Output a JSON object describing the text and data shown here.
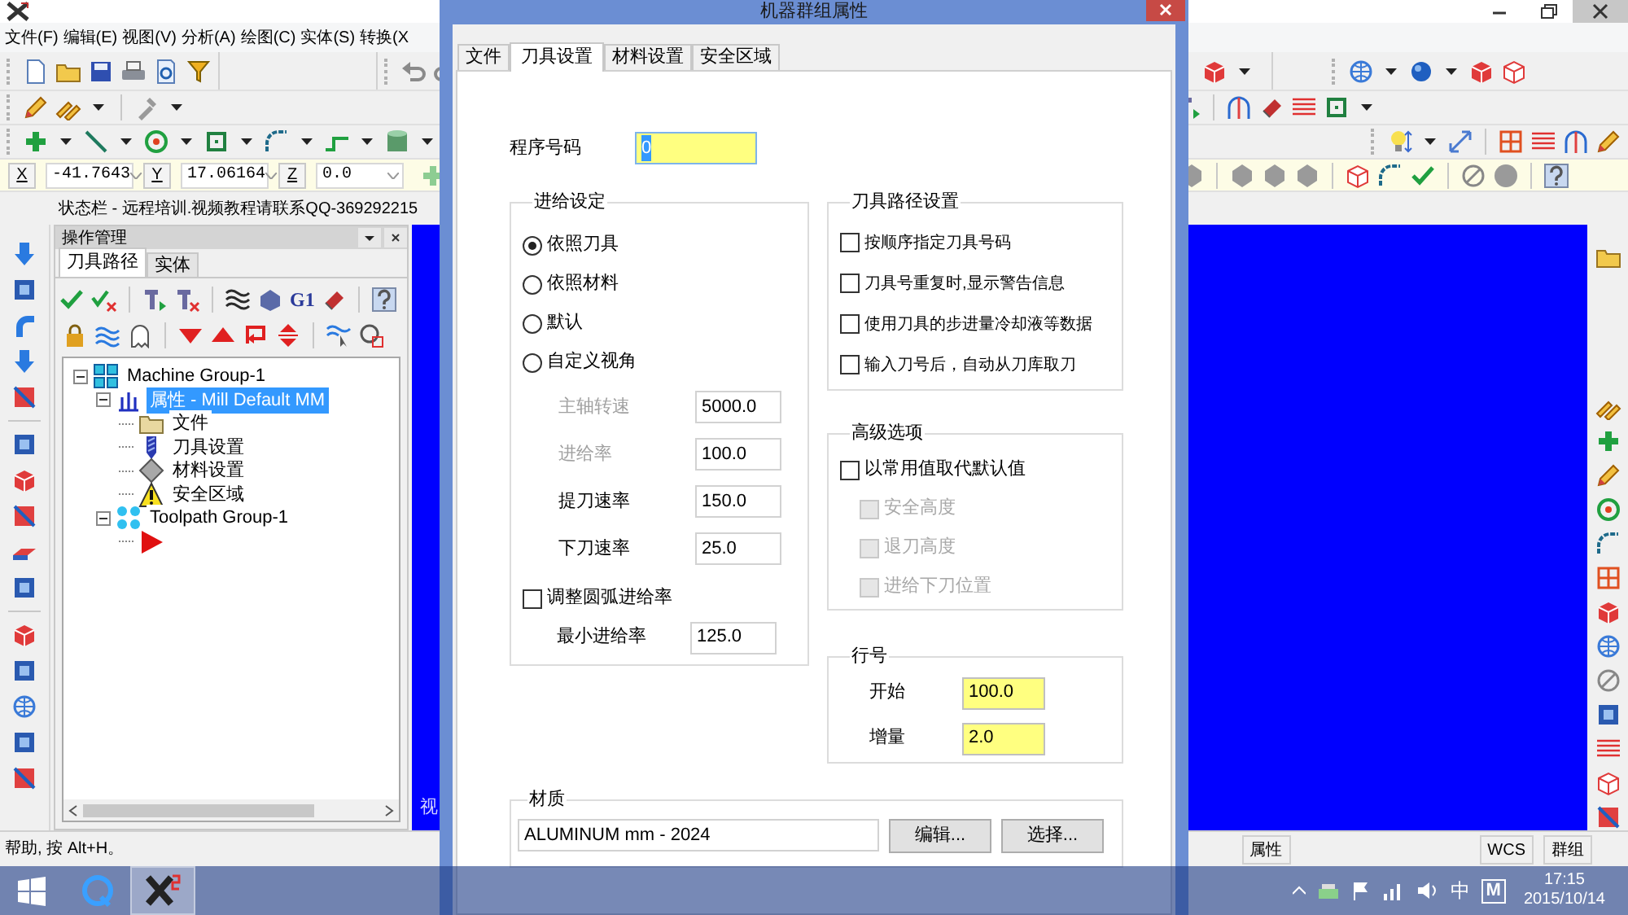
{
  "app": {
    "menu": [
      "文件(F)",
      "编辑(E)",
      "视图(V)",
      "分析(A)",
      "绘图(C)",
      "实体(S)",
      "转换(X"
    ],
    "coordinates": [
      {
        "axis": "X",
        "value": "-41.7643"
      },
      {
        "axis": "Y",
        "value": "17.06164"
      },
      {
        "axis": "Z",
        "value": "0.0"
      }
    ],
    "status_line": "状态栏 - 远程培训.视频教程请联系QQ-369292215",
    "manager": {
      "title": "操作管理",
      "tabs": [
        {
          "label": "刀具路径",
          "selected": true
        },
        {
          "label": "实体",
          "selected": false
        }
      ],
      "toolbar_label": "G1",
      "tree": [
        {
          "kind": "machine-group",
          "label": "Machine Group-1",
          "expanded": true,
          "selected": false,
          "children": [
            {
              "kind": "properties",
              "label": "属性 - Mill Default MM",
              "expanded": true,
              "selected": true,
              "children": [
                {
                  "kind": "files",
                  "label": "文件",
                  "selected": false
                },
                {
                  "kind": "tool",
                  "label": "刀具设置",
                  "selected": false
                },
                {
                  "kind": "material",
                  "label": "材料设置",
                  "selected": false
                },
                {
                  "kind": "safety",
                  "label": "安全区域",
                  "selected": false
                }
              ]
            },
            {
              "kind": "toolpath-group",
              "label": "Toolpath Group-1",
              "expanded": true,
              "selected": false,
              "children": [
                {
                  "kind": "operation-pointer",
                  "selected": false
                }
              ]
            }
          ]
        }
      ]
    },
    "viewport_text": "视",
    "status_bar": {
      "help": "帮助, 按 Alt+H。",
      "items": [
        "属性",
        "WCS",
        "群组"
      ]
    }
  },
  "dialog": {
    "title": "机器群组属性",
    "tabs": [
      {
        "label": "文件",
        "selected": false
      },
      {
        "label": "刀具设置",
        "selected": true
      },
      {
        "label": "材料设置",
        "selected": false
      },
      {
        "label": "安全区域",
        "selected": false
      }
    ],
    "program_number": {
      "label": "程序号码",
      "value": "0",
      "highlighted": true,
      "text_selected": true
    },
    "feed": {
      "title": "进给设定",
      "options": [
        {
          "label": "依照刀具",
          "selected": true
        },
        {
          "label": "依照材料",
          "selected": false
        },
        {
          "label": "默认",
          "selected": false
        },
        {
          "label": "自定义视角",
          "selected": false
        }
      ],
      "rates": [
        {
          "label": "主轴转速",
          "value": "5000.0",
          "disabled": true
        },
        {
          "label": "进给率",
          "value": "100.0",
          "disabled": true
        },
        {
          "label": "提刀速率",
          "value": "150.0",
          "disabled": false
        },
        {
          "label": "下刀速率",
          "value": "25.0",
          "disabled": false
        }
      ],
      "arc_feed": {
        "label": "调整圆弧进给率",
        "checked": false
      },
      "min_feed": {
        "label": "最小进给率",
        "value": "125.0"
      }
    },
    "toolpath_settings": {
      "title": "刀具路径设置",
      "options": [
        {
          "label": "按顺序指定刀具号码",
          "checked": false
        },
        {
          "label": "刀具号重复时,显示警告信息",
          "checked": false
        },
        {
          "label": "使用刀具的步进量冷却液等数据",
          "checked": false
        },
        {
          "label": "输入刀号后，自动从刀库取刀",
          "checked": false
        }
      ]
    },
    "advanced": {
      "title": "高级选项",
      "option": {
        "label": "以常用值取代默认值",
        "checked": false
      },
      "sub_options": [
        {
          "label": "安全高度",
          "checked": false,
          "disabled": true
        },
        {
          "label": "退刀高度",
          "checked": false,
          "disabled": true
        },
        {
          "label": "进给下刀位置",
          "checked": false,
          "disabled": true
        }
      ]
    },
    "line_numbers": {
      "title": "行号",
      "fields": [
        {
          "label": "开始",
          "value": "100.0",
          "highlighted": true
        },
        {
          "label": "增量",
          "value": "2.0",
          "highlighted": true
        }
      ]
    },
    "material": {
      "title": "材质",
      "value": "ALUMINUM mm - 2024",
      "buttons": [
        "编辑...",
        "选择..."
      ]
    }
  },
  "taskbar": {
    "items": [
      {
        "kind": "start",
        "active": false
      },
      {
        "kind": "browser",
        "active": false
      },
      {
        "kind": "cad",
        "active": true
      }
    ],
    "ime": "中",
    "ime_mode": "M",
    "time": "17:15",
    "date": "2015/10/14"
  }
}
